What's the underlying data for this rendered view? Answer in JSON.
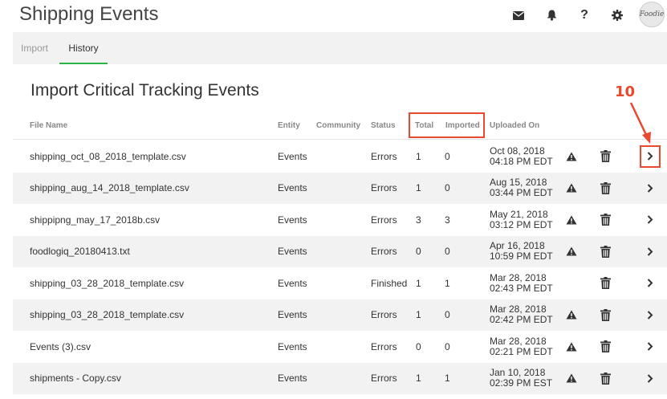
{
  "app": {
    "title": "Shipping Events",
    "avatar_text": "Foodie"
  },
  "header_icons": [
    "mail-icon",
    "bell-icon",
    "help-icon",
    "gear-icon"
  ],
  "tabs": [
    {
      "label": "Import",
      "active": false
    },
    {
      "label": "History",
      "active": true
    }
  ],
  "page": {
    "title": "Import Critical Tracking Events"
  },
  "annotation": {
    "number": "10",
    "color": "#e8492f"
  },
  "table": {
    "columns": {
      "file": "File Name",
      "entity": "Entity",
      "community": "Community",
      "status": "Status",
      "total": "Total",
      "imported": "Imported",
      "uploaded": "Uploaded On"
    },
    "rows": [
      {
        "file": "shipping_oct_08_2018_template.csv",
        "entity": "Events",
        "status": "Errors",
        "total": "1",
        "imported": "0",
        "date": "Oct 08, 2018",
        "time": "04:18 PM EDT",
        "warning": true
      },
      {
        "file": "shipping_aug_14_2018_template.csv",
        "entity": "Events",
        "status": "Errors",
        "total": "1",
        "imported": "0",
        "date": "Aug 15, 2018",
        "time": "03:44 PM EDT",
        "warning": true
      },
      {
        "file": "shippipng_may_17_2018b.csv",
        "entity": "Events",
        "status": "Errors",
        "total": "3",
        "imported": "3",
        "date": "May 21, 2018",
        "time": "03:12 PM EDT",
        "warning": true
      },
      {
        "file": "foodlogiq_20180413.txt",
        "entity": "Events",
        "status": "Errors",
        "total": "0",
        "imported": "0",
        "date": "Apr 16, 2018",
        "time": "10:59 PM EDT",
        "warning": true
      },
      {
        "file": "shipping_03_28_2018_template.csv",
        "entity": "Events",
        "status": "Finished",
        "total": "1",
        "imported": "1",
        "date": "Mar 28, 2018",
        "time": "02:43 PM EDT",
        "warning": false
      },
      {
        "file": "shipping_03_28_2018_template.csv",
        "entity": "Events",
        "status": "Errors",
        "total": "1",
        "imported": "0",
        "date": "Mar 28, 2018",
        "time": "02:42 PM EDT",
        "warning": true
      },
      {
        "file": "Events (3).csv",
        "entity": "Events",
        "status": "Errors",
        "total": "0",
        "imported": "0",
        "date": "Mar 28, 2018",
        "time": "02:21 PM EDT",
        "warning": true
      },
      {
        "file": "shipments - Copy.csv",
        "entity": "Events",
        "status": "Errors",
        "total": "1",
        "imported": "1",
        "date": "Jan 10, 2018",
        "time": "02:39 PM EST",
        "warning": true
      }
    ]
  }
}
